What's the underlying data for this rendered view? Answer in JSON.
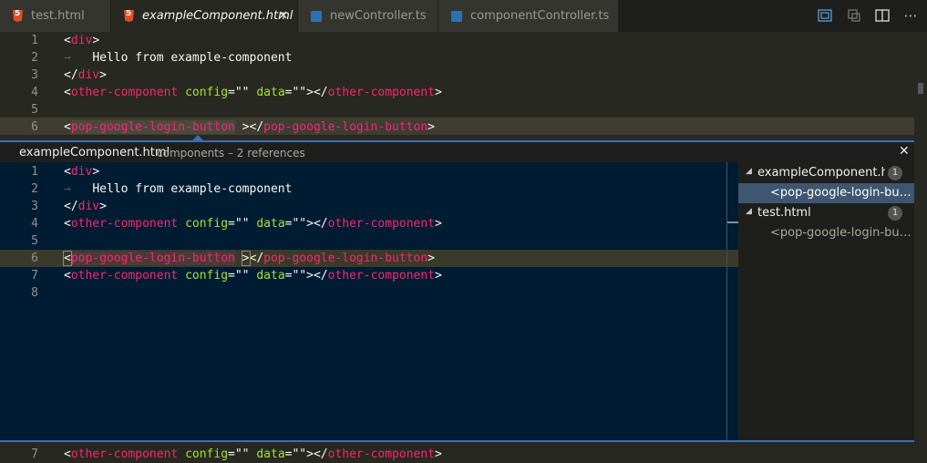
{
  "tabs": [
    {
      "label": "test.html",
      "icon": "html-file-icon",
      "active": false
    },
    {
      "label": "exampleComponent.html",
      "icon": "html-file-icon",
      "active": true
    },
    {
      "label": "newController.ts",
      "icon": "ts-file-icon",
      "active": false
    },
    {
      "label": "componentController.ts",
      "icon": "ts-file-icon",
      "active": false
    }
  ],
  "tab_close_glyph": "✕",
  "toolbar": {
    "more_glyph": "⋯"
  },
  "top_editor": {
    "line_numbers": [
      "1",
      "2",
      "3",
      "4",
      "5",
      "6"
    ]
  },
  "peek": {
    "title": "exampleComponent.html",
    "subtitle": "components – 2 references",
    "close_glyph": "✕",
    "line_numbers": [
      "1",
      "2",
      "3",
      "4",
      "5",
      "6",
      "7",
      "8"
    ],
    "references": [
      {
        "file": "exampleComponent.html",
        "count": "1",
        "lines": [
          "<pop-google-login-button ></pop-google-login-button>"
        ]
      },
      {
        "file": "test.html",
        "count": "1",
        "lines": [
          "<pop-google-login-button ></pop-google-login-button>"
        ]
      }
    ]
  },
  "bottom_editor": {
    "line_numbers": [
      "7"
    ]
  },
  "code": {
    "div_open": "div",
    "hello": "Hello from example-component",
    "div_close": "div",
    "other_tag": "other-component",
    "config_attr": "config",
    "data_attr": "data",
    "empty_str": "\"\"",
    "pop_tag": "pop-google-login-button"
  },
  "colors": {
    "editor_bg": "#272822",
    "peek_bg": "#001c33",
    "tag": "#f92672",
    "attr": "#a6e22e",
    "accent": "#3a6fb2"
  }
}
